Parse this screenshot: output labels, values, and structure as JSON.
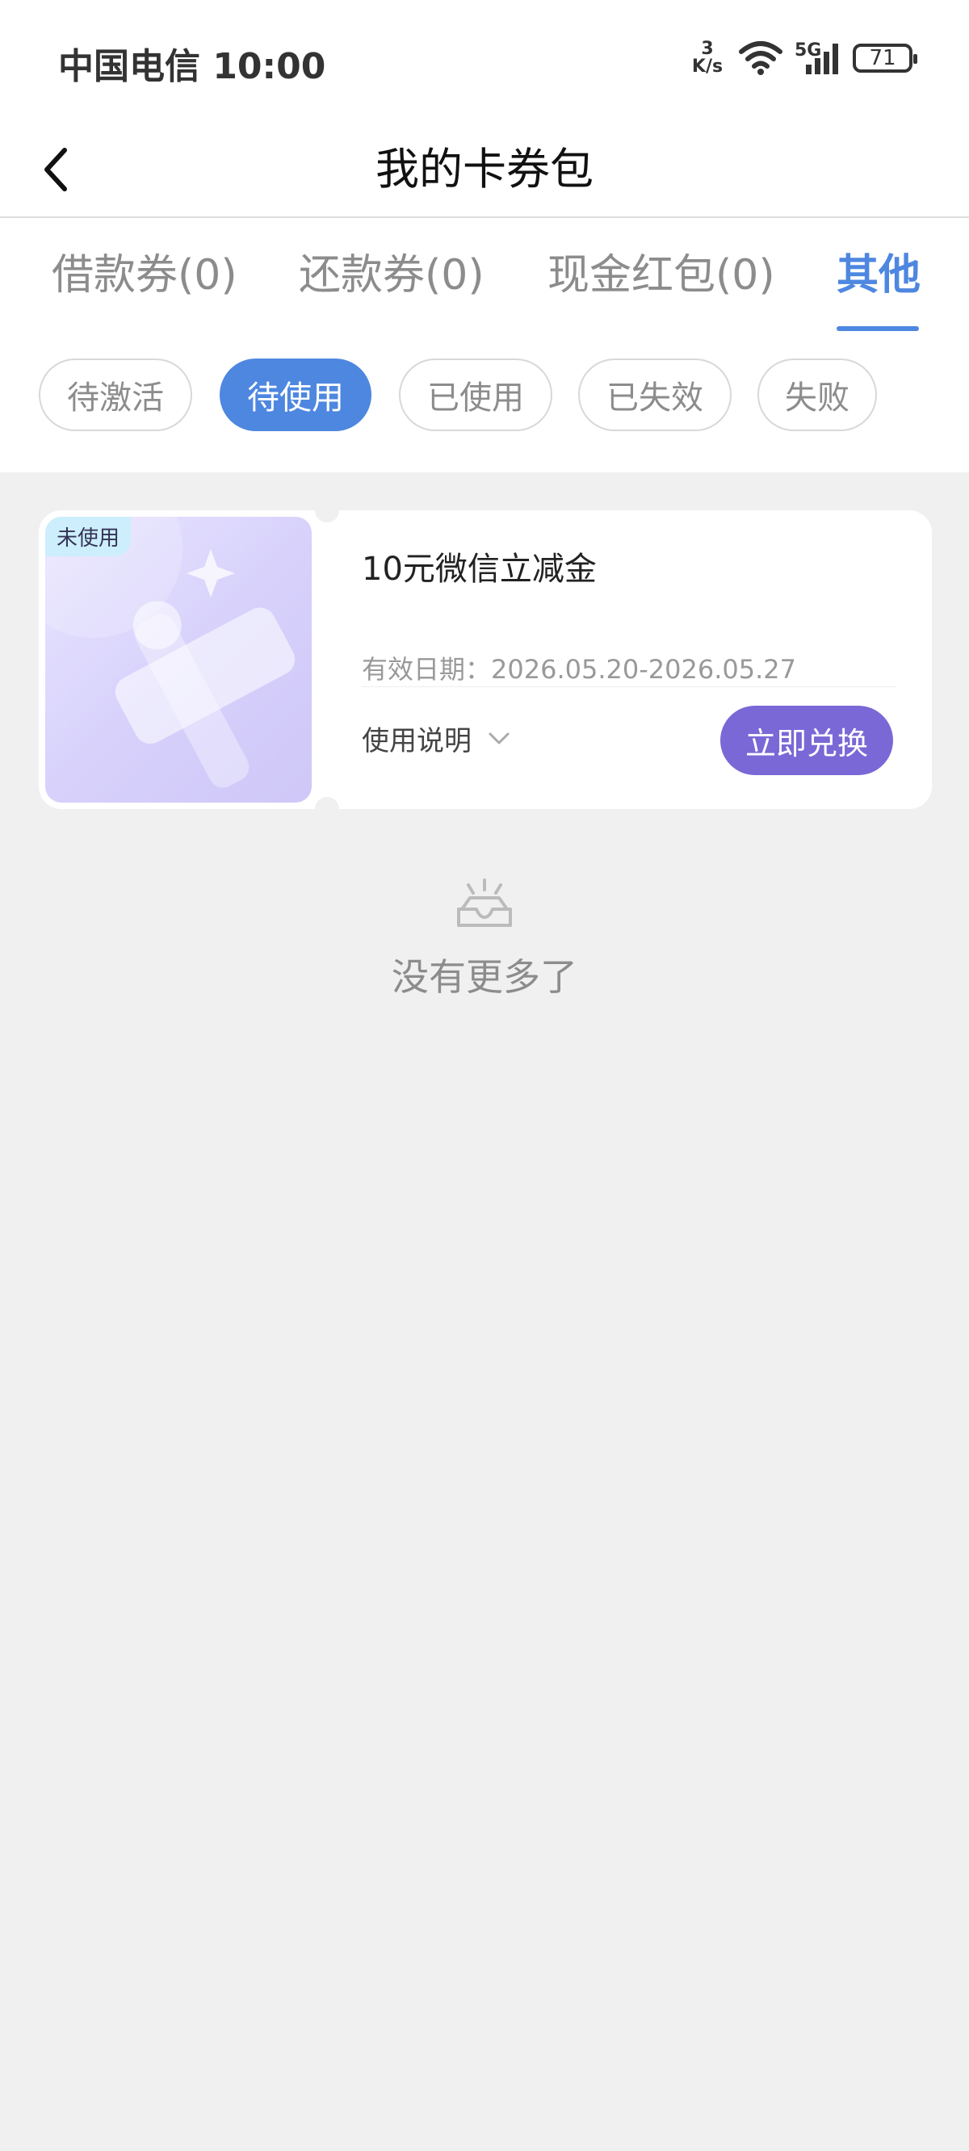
{
  "status_bar": {
    "carrier_time": "中国电信 10:00",
    "speed_value": "3",
    "speed_unit": "K/s",
    "network": "5G",
    "battery": "71",
    "icons": [
      "wifi-icon",
      "signal-icon",
      "battery-icon"
    ]
  },
  "nav": {
    "title": "我的卡券包",
    "back_icon": "chevron-left-icon"
  },
  "tabs": [
    {
      "label": "借款券(0)"
    },
    {
      "label": "还款券(0)"
    },
    {
      "label": "现金红包(0)"
    },
    {
      "label": "其他",
      "active": true
    }
  ],
  "filters": [
    {
      "label": "待激活"
    },
    {
      "label": "待使用",
      "active": true
    },
    {
      "label": "已使用"
    },
    {
      "label": "已失效"
    },
    {
      "label": "失败"
    }
  ],
  "coupon": {
    "badge": "未使用",
    "title": "10元微信立减金",
    "validity": "有效日期：2026.05.20-2026.05.27",
    "usage_label": "使用说明",
    "redeem_label": "立即兑换"
  },
  "empty": {
    "text": "没有更多了",
    "icon": "empty-tray-icon"
  },
  "colors": {
    "accent": "#4e87e0",
    "button_purple": "#7a68d6",
    "background": "#f0f0f0"
  }
}
